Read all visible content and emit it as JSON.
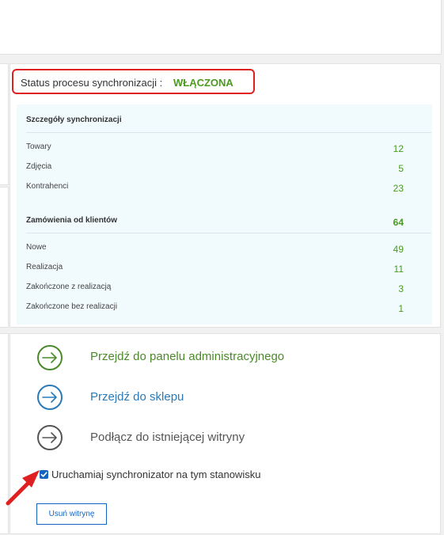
{
  "status": {
    "label": "Status procesu synchronizacji :",
    "value": "WŁĄCZONA"
  },
  "details": {
    "title": "Szczegóły synchronizacji",
    "rows": [
      {
        "label": "Towary",
        "value": "12"
      },
      {
        "label": "Zdjęcia",
        "value": "5"
      },
      {
        "label": "Kontrahenci",
        "value": "23"
      }
    ]
  },
  "orders": {
    "title": "Zamówienia od klientów",
    "total": "64",
    "rows": [
      {
        "label": "Nowe",
        "value": "49"
      },
      {
        "label": "Realizacja",
        "value": "11"
      },
      {
        "label": "Zakończone z realizacją",
        "value": "3"
      },
      {
        "label": "Zakończone bez realizacji",
        "value": "1"
      }
    ]
  },
  "links": [
    {
      "label": "Przejdź do panelu administracyjnego",
      "color": "#4a8a2a",
      "icon": "arrow-right-icon"
    },
    {
      "label": "Przejdź do sklepu",
      "color": "#2a7ab8",
      "icon": "arrow-right-icon"
    },
    {
      "label": "Podłącz do istniejącej witryny",
      "color": "#555555",
      "icon": "arrow-right-icon"
    }
  ],
  "checkbox": {
    "label": "Uruchamiaj synchronizator na tym stanowisku",
    "checked": true
  },
  "remove_button": "Usuń witrynę",
  "colors": {
    "accent_green": "#4a9a1e",
    "highlight_red": "#e02020",
    "primary_blue": "#1565c0"
  }
}
